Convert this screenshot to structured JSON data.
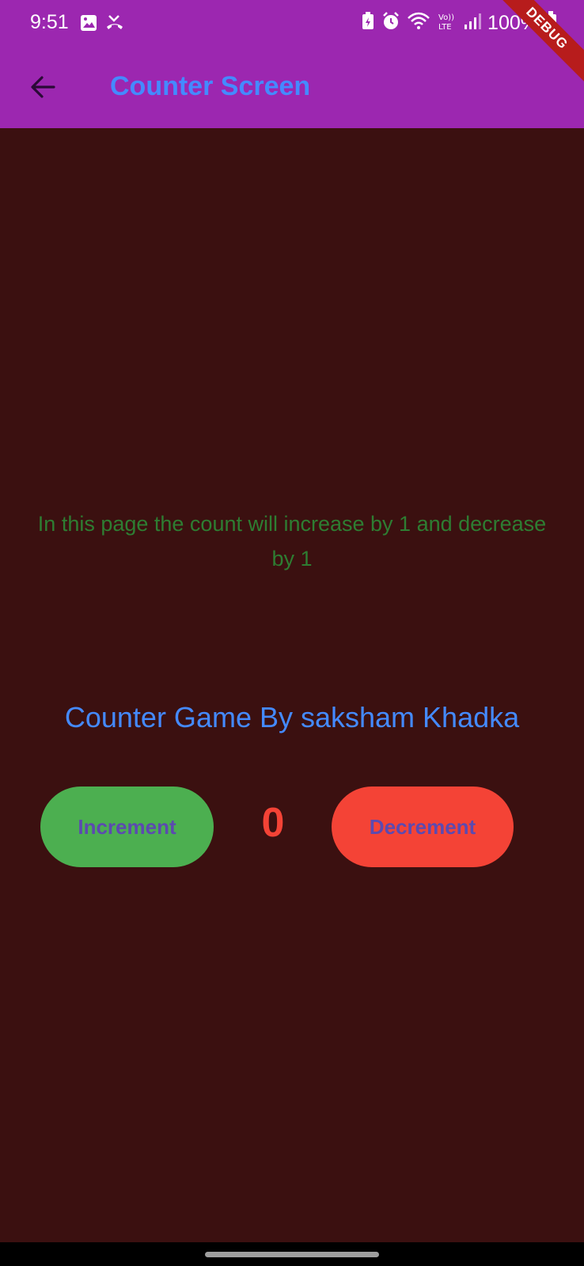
{
  "status_bar": {
    "time": "9:51",
    "battery_text": "100%",
    "left_icons": [
      "image-icon",
      "missed-call-icon"
    ],
    "right_icons": [
      "battery-saver-icon",
      "alarm-icon",
      "wifi-icon",
      "volte-icon",
      "signal-icon",
      "battery-icon"
    ]
  },
  "app_bar": {
    "title": "Counter Screen",
    "back_icon": "arrow-back-icon"
  },
  "debug_banner": "DEBUG",
  "main": {
    "description": "In this page the count will increase by 1 and decrease by 1",
    "game_title": "Counter Game By saksham Khadka",
    "increment_label": "Increment",
    "decrement_label": "Decrement",
    "counter_value": "0"
  },
  "colors": {
    "app_bar": "#9c27b0",
    "background": "#3b1010",
    "title": "#448aff",
    "description": "#2e7d32",
    "increment_button": "#4caf50",
    "decrement_button": "#f44336",
    "button_text": "#5c4ab0",
    "counter": "#f44336"
  }
}
